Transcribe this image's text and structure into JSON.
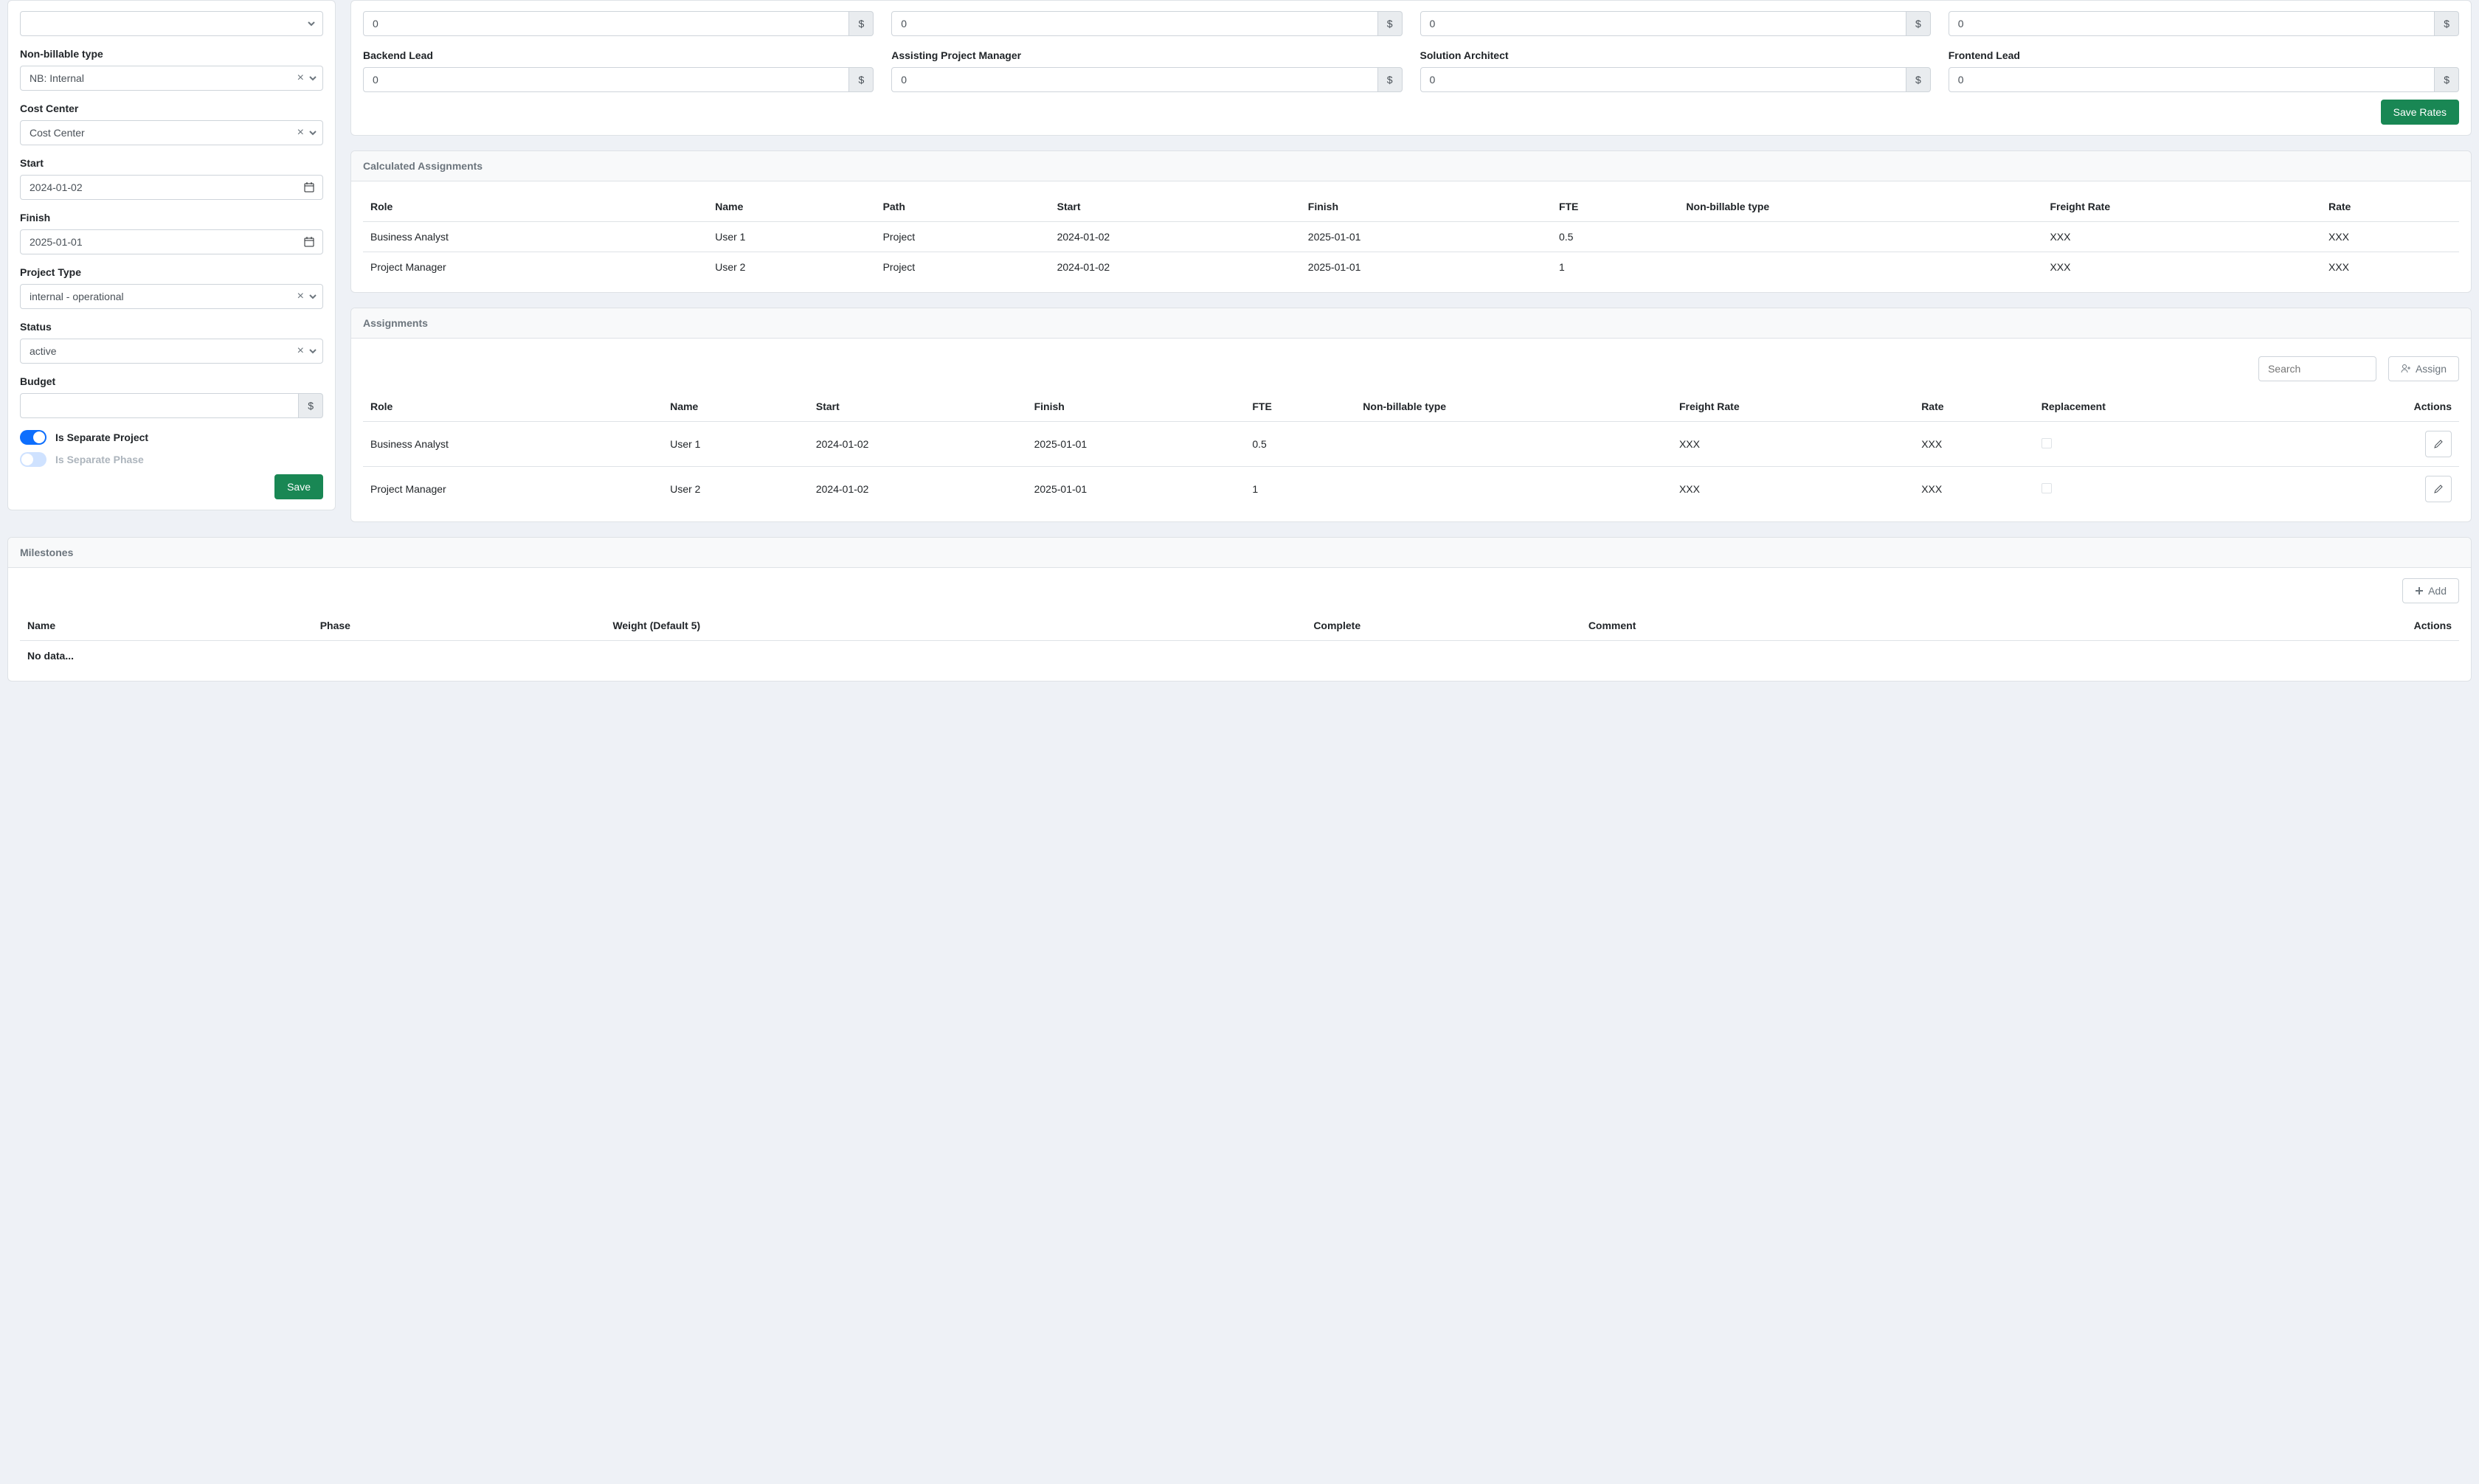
{
  "form": {
    "unnamed_select": "",
    "non_billable_label": "Non-billable type",
    "non_billable_value": "NB: Internal",
    "cost_center_label": "Cost Center",
    "cost_center_value": "Cost Center",
    "start_label": "Start",
    "start_value": "2024-01-02",
    "finish_label": "Finish",
    "finish_value": "2025-01-01",
    "project_type_label": "Project Type",
    "project_type_value": "internal - operational",
    "status_label": "Status",
    "status_value": "active",
    "budget_label": "Budget",
    "budget_value": "",
    "budget_suffix": "$",
    "separate_project_label": "Is Separate Project",
    "separate_phase_label": "Is Separate Phase",
    "save_label": "Save"
  },
  "rates": {
    "row1": [
      {
        "label": "",
        "value": "0"
      },
      {
        "label": "",
        "value": "0"
      },
      {
        "label": "",
        "value": "0"
      },
      {
        "label": "",
        "value": "0"
      }
    ],
    "row2": [
      {
        "label": "Backend Lead",
        "value": "0"
      },
      {
        "label": "Assisting Project Manager",
        "value": "0"
      },
      {
        "label": "Solution Architect",
        "value": "0"
      },
      {
        "label": "Frontend Lead",
        "value": "0"
      }
    ],
    "suffix": "$",
    "save_rates_label": "Save Rates"
  },
  "calc": {
    "header": "Calculated Assignments",
    "cols": {
      "role": "Role",
      "name": "Name",
      "path": "Path",
      "start": "Start",
      "finish": "Finish",
      "fte": "FTE",
      "nb": "Non-billable type",
      "freight": "Freight Rate",
      "rate": "Rate"
    },
    "rows": [
      {
        "role": "Business Analyst",
        "name": "User 1",
        "path": "Project",
        "start": "2024-01-02",
        "finish": "2025-01-01",
        "fte": "0.5",
        "nb": "",
        "freight": "XXX",
        "rate": "XXX"
      },
      {
        "role": "Project Manager",
        "name": "User 2",
        "path": "Project",
        "start": "2024-01-02",
        "finish": "2025-01-01",
        "fte": "1",
        "nb": "",
        "freight": "XXX",
        "rate": "XXX"
      }
    ]
  },
  "assign": {
    "header": "Assignments",
    "search_placeholder": "Search",
    "assign_label": "Assign",
    "cols": {
      "role": "Role",
      "name": "Name",
      "start": "Start",
      "finish": "Finish",
      "fte": "FTE",
      "nb": "Non-billable type",
      "freight": "Freight Rate",
      "rate": "Rate",
      "replacement": "Replacement",
      "actions": "Actions"
    },
    "rows": [
      {
        "role": "Business Analyst",
        "name": "User 1",
        "start": "2024-01-02",
        "finish": "2025-01-01",
        "fte": "0.5",
        "nb": "",
        "freight": "XXX",
        "rate": "XXX"
      },
      {
        "role": "Project Manager",
        "name": "User 2",
        "start": "2024-01-02",
        "finish": "2025-01-01",
        "fte": "1",
        "nb": "",
        "freight": "XXX",
        "rate": "XXX"
      }
    ]
  },
  "milestones": {
    "header": "Milestones",
    "add_label": "Add",
    "cols": {
      "name": "Name",
      "phase": "Phase",
      "weight": "Weight (Default 5)",
      "complete": "Complete",
      "comment": "Comment",
      "actions": "Actions"
    },
    "empty": "No data..."
  }
}
